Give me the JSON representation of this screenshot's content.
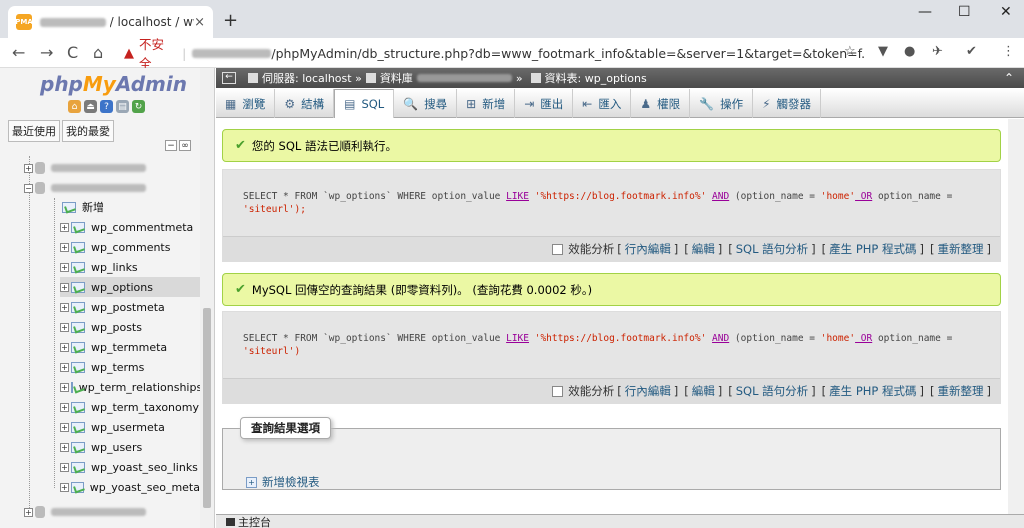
{
  "browser": {
    "tab_title": "/ localhost / www",
    "new_tab": "+",
    "back": "←",
    "forward": "→",
    "reload": "C",
    "home": "⌂",
    "insecure_label": "不安全",
    "url": "/phpMyAdmin/db_structure.php?db=www_footmark_info&table=&server=1&target=&token=f...",
    "minimize": "—",
    "maximize": "☐",
    "close": "✕",
    "tab_close": "×"
  },
  "sidebar": {
    "logo_php": "php",
    "logo_my": "My",
    "logo_admin": "Admin",
    "tab_recent": "最近使用",
    "tab_favorites": "我的最愛",
    "new_item": "新增",
    "tables": [
      "wp_commentmeta",
      "wp_comments",
      "wp_links",
      "wp_options",
      "wp_postmeta",
      "wp_posts",
      "wp_termmeta",
      "wp_terms",
      "wp_term_relationships",
      "wp_term_taxonomy",
      "wp_usermeta",
      "wp_users",
      "wp_yoast_seo_links",
      "wp_yoast_seo_meta"
    ],
    "selected_table": "wp_options"
  },
  "breadcrumb": {
    "server": "伺服器: localhost »",
    "database": "資料庫",
    "table": "資料表: wp_options"
  },
  "menu": {
    "tabs": [
      "瀏覽",
      "結構",
      "SQL",
      "搜尋",
      "新增",
      "匯出",
      "匯入",
      "權限",
      "操作",
      "觸發器"
    ],
    "icons": [
      "▦",
      "⚙",
      "▤",
      "🔍",
      "⊞",
      "⇥",
      "⇤",
      "♟",
      "🔧",
      "⚡"
    ],
    "active": "SQL"
  },
  "result1": {
    "message": "您的 SQL 語法已順利執行。",
    "sql_line1_pre": "SELECT * FROM `wp_options` WHERE option_value ",
    "sql_like": "LIKE",
    "sql_str": " '%https://blog.footmark.info%' ",
    "sql_and": "AND",
    "sql_mid": " (option_name = ",
    "sql_home": "'home'",
    "sql_or": " OR",
    "sql_end": " option_name =",
    "sql_line2": "'siteurl');"
  },
  "result2": {
    "message": "MySQL 回傳空的查詢結果 (即零資料列)。 (查詢花費 0.0002 秒。)",
    "sql_line2": "'siteurl')"
  },
  "sql_links": {
    "profiling": "效能分析",
    "inline_edit": "行內編輯",
    "edit": "編輯",
    "explain": "SQL 語句分析",
    "create_php": "產生 PHP 程式碼",
    "refresh": "重新整理"
  },
  "query_options": {
    "legend": "查詢結果選項",
    "create_view": "新增檢視表"
  },
  "console": {
    "label": "主控台"
  }
}
